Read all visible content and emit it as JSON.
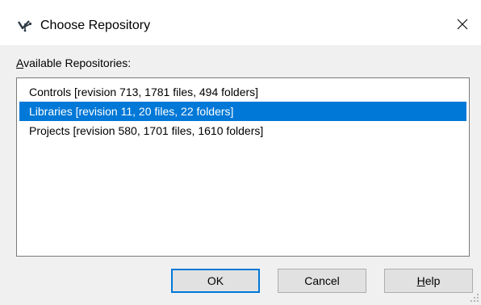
{
  "window": {
    "title": "Choose Repository",
    "app_icon": "branch-check-icon",
    "close_icon": "close-icon"
  },
  "repositories": {
    "label_accel": "A",
    "label_rest": "vailable Repositories:",
    "items": [
      "Controls [revision 713, 1781 files, 494 folders]",
      "Libraries [revision 11, 20 files, 22 folders]",
      "Projects [revision 580, 1701 files, 1610 folders]"
    ],
    "selected_index": 1
  },
  "buttons": {
    "ok": "OK",
    "cancel": "Cancel",
    "help_accel": "H",
    "help_rest": "elp"
  },
  "colors": {
    "selection": "#0078d7",
    "default_button_border": "#0078d7",
    "dialog_background": "#f0f0f0"
  }
}
